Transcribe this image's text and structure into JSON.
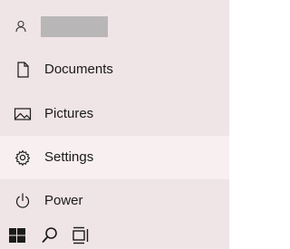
{
  "user": {
    "name_hidden": true,
    "avatar_icon": "person-icon"
  },
  "menu": {
    "items": [
      {
        "label": "Documents",
        "icon": "document-icon"
      },
      {
        "label": "Pictures",
        "icon": "picture-icon"
      },
      {
        "label": "Settings",
        "icon": "gear-icon",
        "hovered": true
      },
      {
        "label": "Power",
        "icon": "power-icon"
      }
    ]
  },
  "taskbar": {
    "buttons": [
      {
        "icon": "windows-logo-icon"
      },
      {
        "icon": "search-icon"
      },
      {
        "icon": "task-view-icon"
      }
    ]
  },
  "colors": {
    "panel_bg": "#efe4e6",
    "hover_bg": "#f7eff0",
    "redaction": "#b9b6b7",
    "icon": "#1a1a1a"
  }
}
